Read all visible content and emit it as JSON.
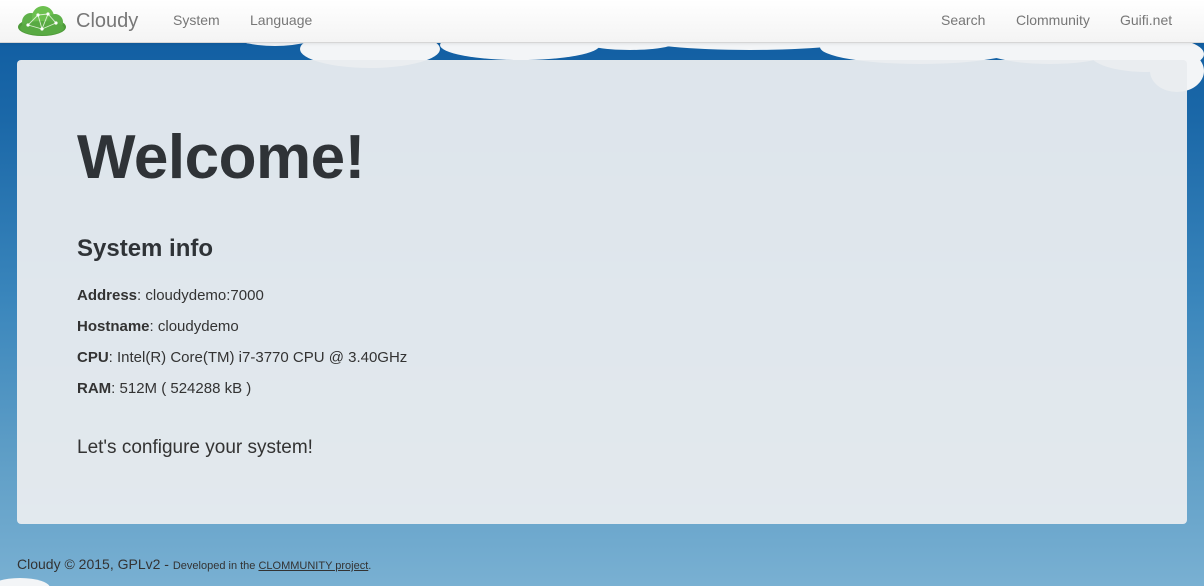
{
  "navbar": {
    "brand": "Cloudy",
    "left_links": [
      "System",
      "Language"
    ],
    "right_links": [
      "Search",
      "Clommunity",
      "Guifi.net"
    ]
  },
  "main": {
    "title": "Welcome!",
    "section_title": "System info",
    "info": [
      {
        "label": "Address",
        "value": ": cloudydemo:7000"
      },
      {
        "label": "Hostname",
        "value": ": cloudydemo"
      },
      {
        "label": "CPU",
        "value": ": Intel(R) Core(TM) i7-3770 CPU @ 3.40GHz"
      },
      {
        "label": "RAM",
        "value": ": 512M ( 524288 kB )"
      }
    ],
    "lead": "Let's configure your system!"
  },
  "footer": {
    "text": "Cloudy © 2015, GPLv2 - ",
    "small": "Developed in the ",
    "link": "CLOMMUNITY project",
    "end": "."
  },
  "colors": {
    "background": "#1b68a8",
    "card": "#e9ecef",
    "heading": "#2f3337",
    "nav_text": "#777777",
    "logo_green": "#5fb14a"
  },
  "icons": {
    "brand_logo": "cloud-network-logo-icon"
  }
}
